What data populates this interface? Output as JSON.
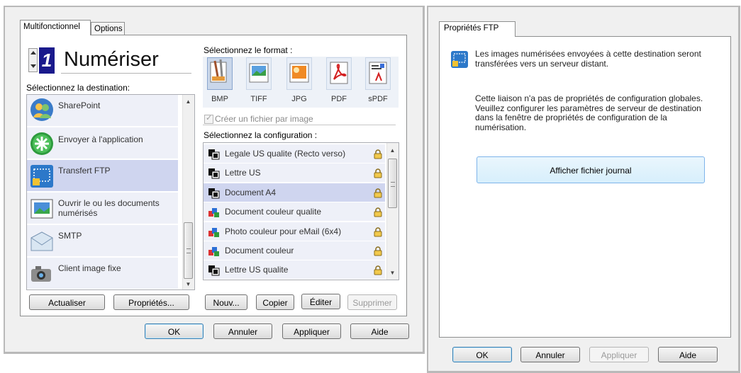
{
  "left": {
    "tabs": [
      {
        "label": "Multifonctionnel"
      },
      {
        "label": "Options"
      }
    ],
    "counter": "1",
    "action": "Numériser",
    "dest_label": "Sélectionnez la destination:",
    "destinations": [
      {
        "label": "SharePoint",
        "icon": "sharepoint-icon"
      },
      {
        "label": "Envoyer à l'application",
        "icon": "green-plus-icon"
      },
      {
        "label": "Transfert FTP",
        "icon": "ftp-icon",
        "selected": true
      },
      {
        "label": "Ouvrir le ou les documents numérisés",
        "icon": "document-image-icon"
      },
      {
        "label": "SMTP",
        "icon": "mail-envelope-icon"
      },
      {
        "label": "Client image fixe",
        "icon": "camera-icon"
      }
    ],
    "format_label": "Sélectionnez le format :",
    "formats": [
      {
        "label": "BMP",
        "selected": true
      },
      {
        "label": "TIFF"
      },
      {
        "label": "JPG"
      },
      {
        "label": "PDF"
      },
      {
        "label": "sPDF"
      }
    ],
    "checkbox_label": "Créer un fichier par image",
    "config_label": "Sélectionnez la configuration :",
    "configs": [
      {
        "label": "Legale US qualite (Recto verso)",
        "icon": "bw-page-icon"
      },
      {
        "label": "Lettre US",
        "icon": "bw-page-icon"
      },
      {
        "label": "Document A4",
        "icon": "bw-page-icon",
        "selected": true
      },
      {
        "label": "Document couleur qualite",
        "icon": "color-blocks-icon"
      },
      {
        "label": "Photo couleur pour eMail (6x4)",
        "icon": "color-blocks-icon"
      },
      {
        "label": "Document couleur",
        "icon": "color-blocks-icon"
      },
      {
        "label": "Lettre US qualite",
        "icon": "bw-page-icon"
      }
    ],
    "buttons": {
      "refresh": "Actualiser",
      "properties": "Propriétés...",
      "new": "Nouv...",
      "copy": "Copier",
      "edit": "Éditer",
      "delete": "Supprimer",
      "ok": "OK",
      "cancel": "Annuler",
      "apply": "Appliquer",
      "help": "Aide"
    }
  },
  "right": {
    "tab": "Propriétés FTP",
    "info1": "Les images numérisées envoyées à cette destination seront transférées vers un serveur distant.",
    "info2": "Cette liaison n'a pas de propriétés de configuration globales. Veuillez configurer les paramètres de serveur de destination dans la fenêtre de propriétés de configuration de la numérisation.",
    "log_button": "Afficher fichier journal",
    "buttons": {
      "ok": "OK",
      "cancel": "Annuler",
      "apply": "Appliquer",
      "help": "Aide"
    }
  },
  "colors": {
    "selection": "#cfd5ef",
    "list_bg": "#eef0f8",
    "counter_bg": "#1a1a8c",
    "counter_fg": "#ffffff"
  }
}
